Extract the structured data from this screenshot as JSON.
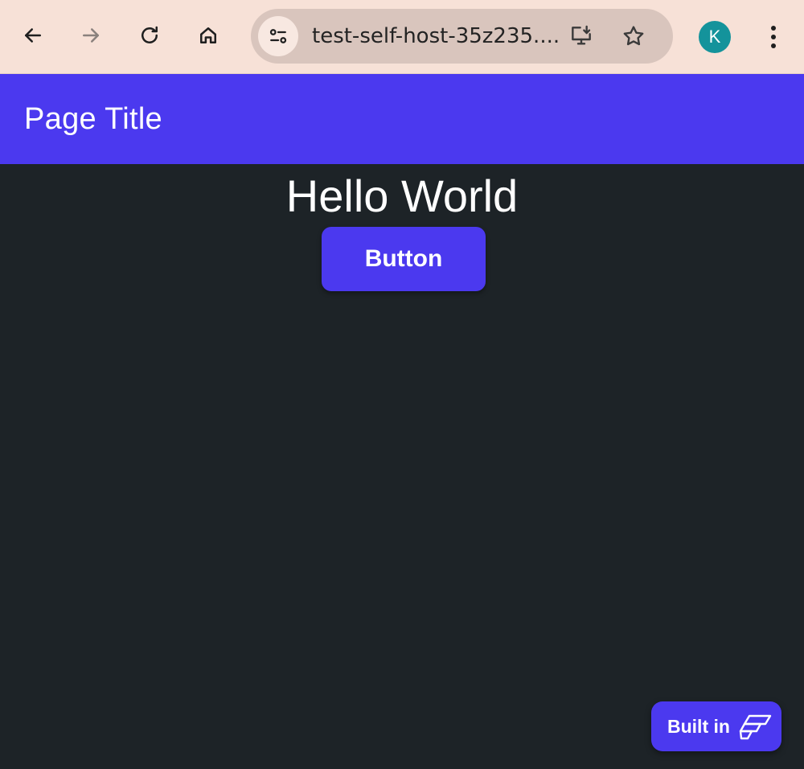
{
  "browser": {
    "url": "test-self-host-35z235....",
    "profile_initial": "K",
    "icons": {
      "back": "back-arrow-icon",
      "forward": "forward-arrow-icon",
      "reload": "reload-icon",
      "home": "home-icon",
      "site_info": "site-info-icon",
      "install": "install-app-icon",
      "bookmark": "bookmark-star-icon",
      "menu": "kebab-menu-icon"
    },
    "colors": {
      "toolbar": "#f7e1d7",
      "omnibox": "#d9c5bd",
      "avatar": "#14939b"
    }
  },
  "header": {
    "title": "Page Title"
  },
  "main": {
    "heading": "Hello World",
    "button_label": "Button"
  },
  "badge": {
    "label": "Built in",
    "logo_icon": "flutterflow-logo-icon"
  },
  "colors": {
    "primary": "#4b39ef",
    "background": "#1d2327",
    "text": "#ffffff"
  }
}
